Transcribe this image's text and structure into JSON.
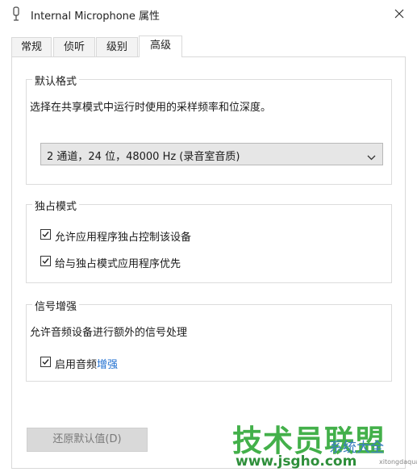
{
  "window": {
    "title": "Internal Microphone 属性",
    "close_icon": "close-icon",
    "title_icon": "microphone-icon"
  },
  "tabs": [
    {
      "label": "常规",
      "active": false
    },
    {
      "label": "侦听",
      "active": false
    },
    {
      "label": "级别",
      "active": false
    },
    {
      "label": "高级",
      "active": true
    }
  ],
  "default_format": {
    "legend": "默认格式",
    "description": "选择在共享模式中运行时使用的采样频率和位深度。",
    "selected_value": "2 通道，24 位，48000 Hz (录音室音质)"
  },
  "exclusive_mode": {
    "legend": "独占模式",
    "options": [
      {
        "label": "允许应用程序独占控制该设备",
        "checked": true
      },
      {
        "label": "给与独占模式应用程序优先",
        "checked": true
      }
    ]
  },
  "signal_enhancement": {
    "legend": "信号增强",
    "description": "允许音频设备进行额外的信号处理",
    "option": {
      "label_prefix": "启用音频",
      "label_highlight": "增强",
      "checked": true
    }
  },
  "footer": {
    "restore_defaults_label": "还原默认值(D)",
    "restore_defaults_enabled": false
  },
  "watermark": {
    "main": "技术员联盟",
    "url": "www.jsgho.com",
    "brand": "系统大全",
    "small": "xitongdaquan"
  },
  "colors": {
    "accent_link": "#1f6fd1",
    "watermark_green": "#43b04a"
  }
}
